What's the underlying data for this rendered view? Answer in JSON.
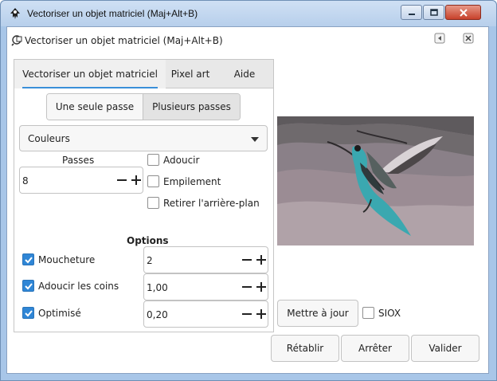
{
  "window": {
    "title": "Vectoriser un objet matriciel (Maj+Alt+B)"
  },
  "dock": {
    "title": "Vectoriser un objet matriciel (Maj+Alt+B)"
  },
  "tabs": [
    {
      "label": "Vectoriser un objet matriciel"
    },
    {
      "label": "Pixel art"
    },
    {
      "label": "Aide"
    }
  ],
  "mode": {
    "single_label": "Une seule passe",
    "multi_label": "Plusieurs passes",
    "selected": "Plusieurs passes"
  },
  "scan_type": {
    "selected": "Couleurs"
  },
  "passes": {
    "label": "Passes",
    "value": "8"
  },
  "pass_options": {
    "smooth": {
      "label": "Adoucir",
      "checked": false
    },
    "stack": {
      "label": "Empilement",
      "checked": false
    },
    "remove_bg": {
      "label": "Retirer l'arrière-plan",
      "checked": false
    }
  },
  "options": {
    "heading": "Options",
    "speckles": {
      "label": "Moucheture",
      "checked": true,
      "value": "2"
    },
    "smooth_corners": {
      "label": "Adoucir les coins",
      "checked": true,
      "value": "1,00"
    },
    "optimize": {
      "label": "Optimisé",
      "checked": true,
      "value": "0,20"
    }
  },
  "preview": {
    "update_label": "Mettre à jour",
    "siox_label": "SIOX",
    "siox_checked": false
  },
  "footer": {
    "reset_label": "Rétablir",
    "stop_label": "Arrêter",
    "ok_label": "Valider"
  },
  "colors": {
    "accent": "#2f86d6",
    "title_bar": "#b7cfeb",
    "bird_teal": "#3aa8b0"
  }
}
